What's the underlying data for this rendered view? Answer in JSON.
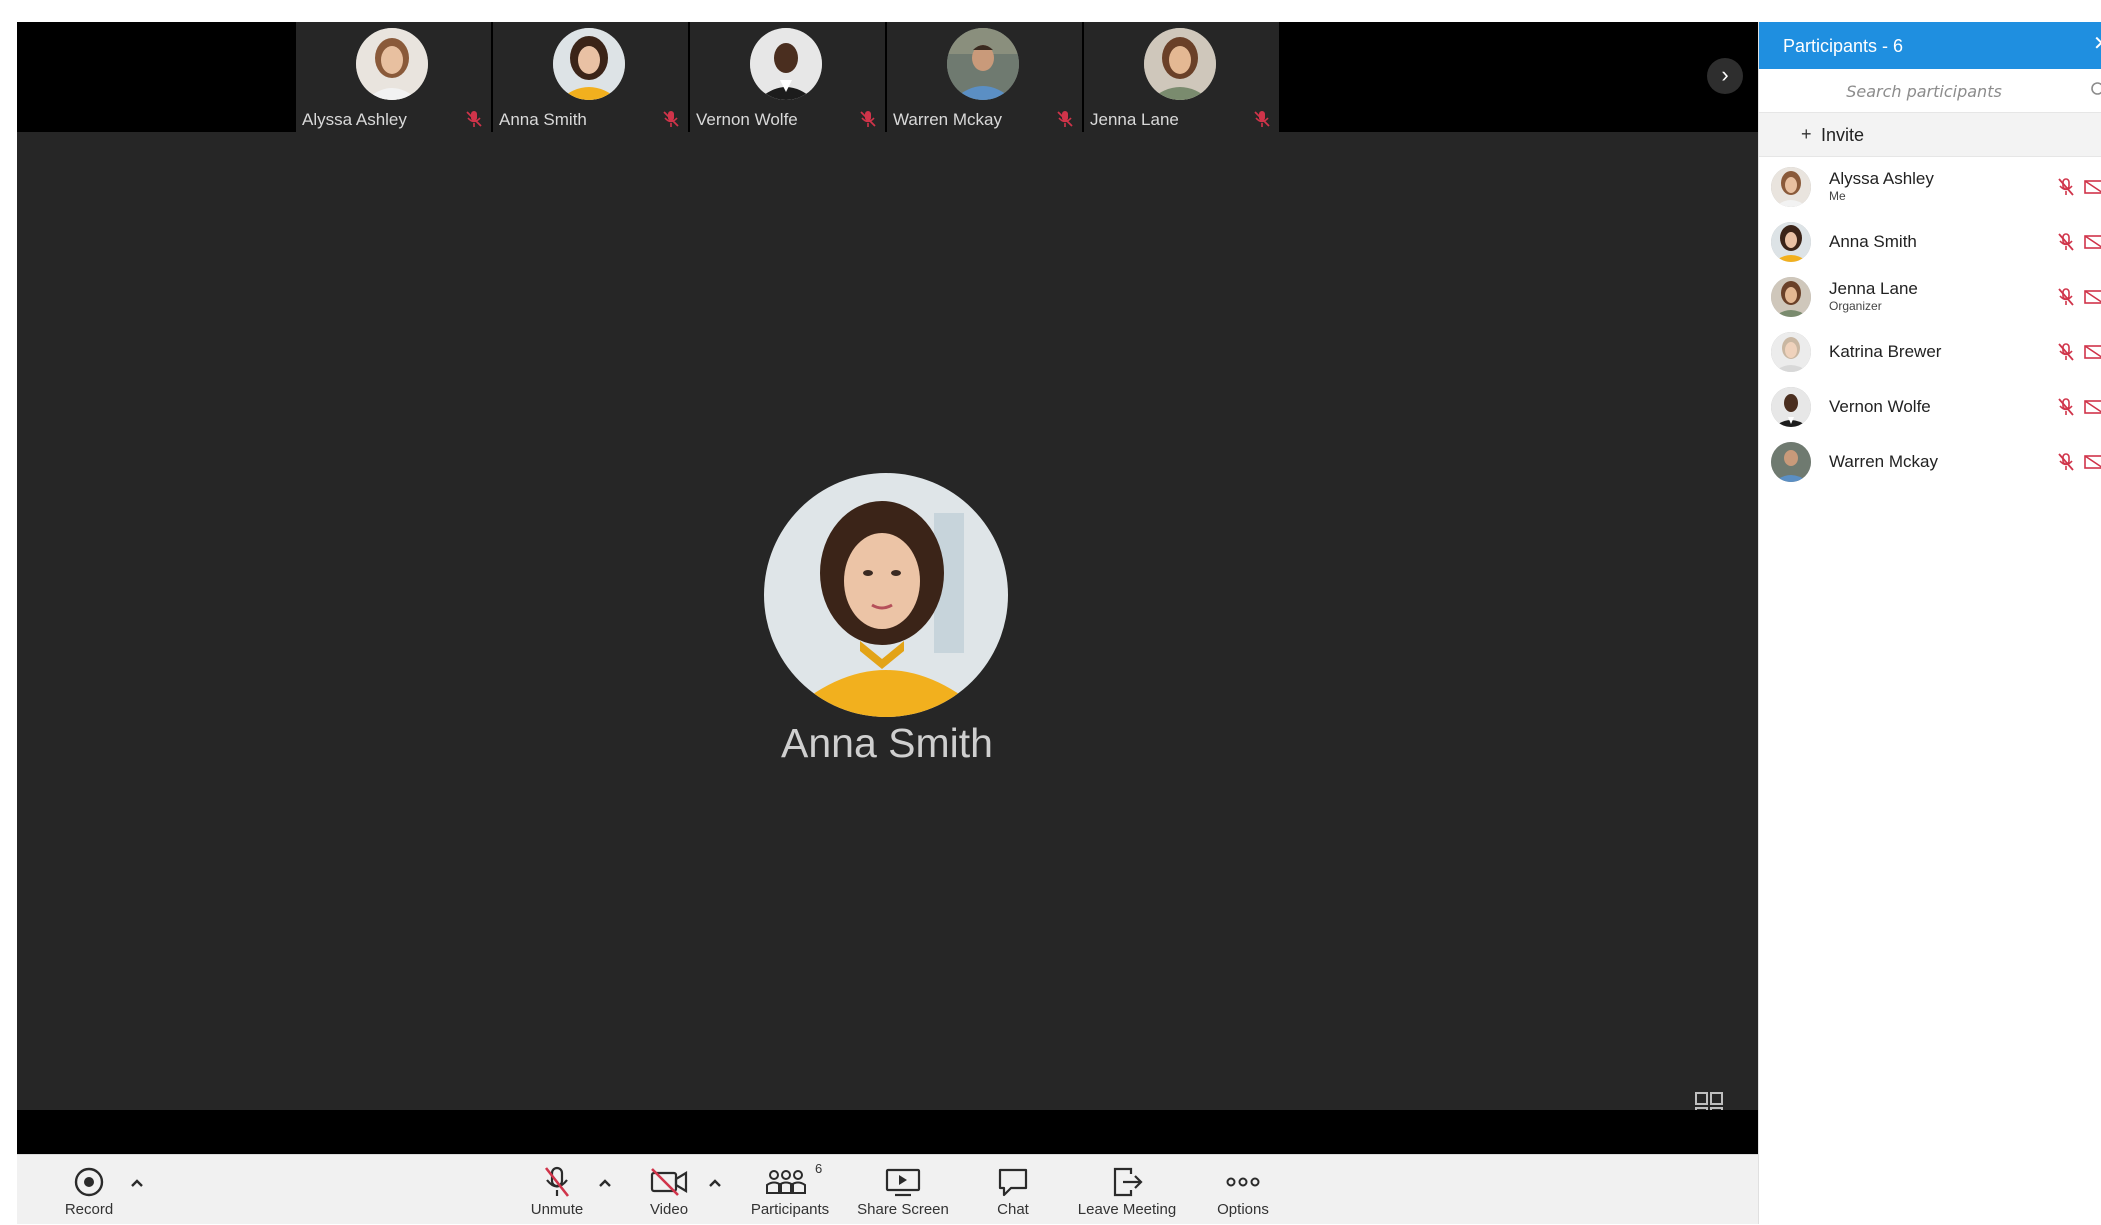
{
  "stage": {
    "filmstrip": [
      {
        "name": "Alyssa Ashley"
      },
      {
        "name": "Anna Smith"
      },
      {
        "name": "Vernon Wolfe"
      },
      {
        "name": "Warren Mckay"
      },
      {
        "name": "Jenna Lane"
      }
    ],
    "active_speaker": "Anna Smith"
  },
  "toolbar": {
    "record": "Record",
    "unmute": "Unmute",
    "video": "Video",
    "participants": "Participants",
    "participants_count": "6",
    "share_screen": "Share Screen",
    "chat": "Chat",
    "leave": "Leave Meeting",
    "options": "Options"
  },
  "sidebar": {
    "title": "Participants - 6",
    "search_placeholder": "Search participants",
    "invite": "Invite",
    "participants": [
      {
        "name": "Alyssa Ashley",
        "role": "Me"
      },
      {
        "name": "Anna Smith",
        "role": ""
      },
      {
        "name": "Jenna Lane",
        "role": "Organizer"
      },
      {
        "name": "Katrina Brewer",
        "role": ""
      },
      {
        "name": "Vernon Wolfe",
        "role": ""
      },
      {
        "name": "Warren Mckay",
        "role": ""
      }
    ]
  },
  "colors": {
    "accent": "#1f8fe0",
    "stage_bg": "#262626",
    "muted_red": "#d0344a"
  },
  "icons": [
    "record-icon",
    "caret-up-icon",
    "mic-muted-icon",
    "video-off-icon",
    "participants-icon",
    "share-screen-icon",
    "chat-icon",
    "leave-icon",
    "more-icon",
    "grid-layout-icon",
    "chevron-right-icon",
    "search-icon",
    "close-icon",
    "plus-icon"
  ]
}
